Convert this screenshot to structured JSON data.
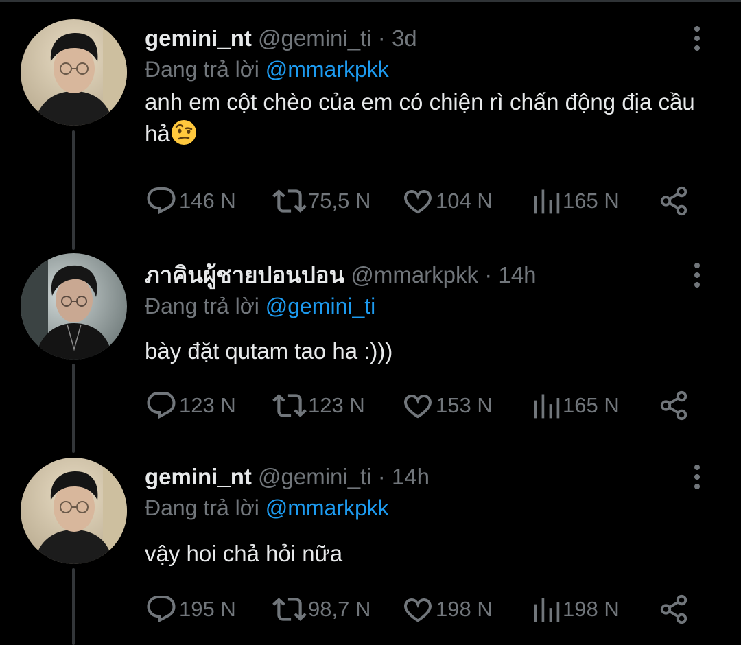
{
  "colors": {
    "background": "#000000",
    "text_primary": "#e7e9ea",
    "text_secondary": "#71767b",
    "mention": "#1d9bf0",
    "thread_line": "#333639"
  },
  "tweets": [
    {
      "display_name": "gemini_nt",
      "handle": "@gemini_ti",
      "separator": "·",
      "time": "3d",
      "reply_prefix": "Đang trả lời",
      "reply_to": "@mmarkpkk",
      "text": "anh em cột chèo của em có chiện rì chấn động địa cầu hả",
      "emoji": "face-with-raised-eyebrow",
      "replies": "146 N",
      "retweets": "75,5 N",
      "likes": "104 N",
      "views": "165 N"
    },
    {
      "display_name": "ภาคินผู้ชายปอนปอน",
      "handle": "@mmarkpkk",
      "separator": "·",
      "time": "14h",
      "reply_prefix": "Đang trả lời",
      "reply_to": "@gemini_ti",
      "text": "bày đặt qutam tao ha :)))",
      "replies": "123 N",
      "retweets": "123 N",
      "likes": "153 N",
      "views": "165 N"
    },
    {
      "display_name": "gemini_nt",
      "handle": "@gemini_ti",
      "separator": "·",
      "time": "14h",
      "reply_prefix": "Đang trả lời",
      "reply_to": "@mmarkpkk",
      "text": "vậy hoi chả hỏi nữa",
      "replies": "195 N",
      "retweets": "98,7 N",
      "likes": "198 N",
      "views": "198 N"
    }
  ],
  "icons": {
    "reply": "reply-icon",
    "retweet": "retweet-icon",
    "like": "like-icon",
    "views": "views-icon",
    "share": "share-icon",
    "more": "more-icon"
  }
}
